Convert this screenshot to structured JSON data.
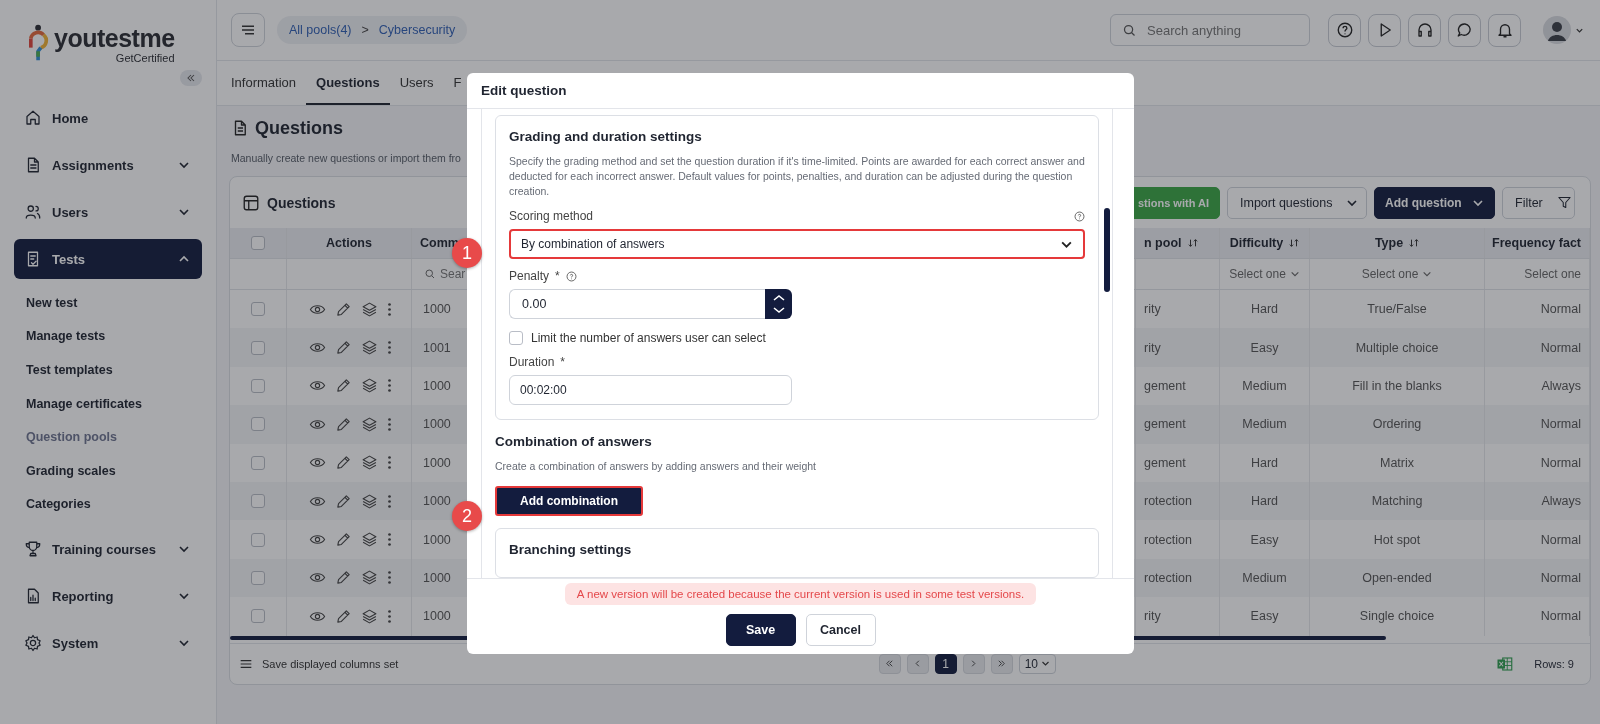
{
  "sidebar": {
    "brand": "youtestme",
    "tagline": "GetCertified",
    "items": [
      {
        "label": "Home",
        "expandable": false,
        "selected": false
      },
      {
        "label": "Assignments",
        "expandable": true,
        "expanded": false,
        "selected": false
      },
      {
        "label": "Users",
        "expandable": true,
        "expanded": false,
        "selected": false
      },
      {
        "label": "Tests",
        "expandable": true,
        "expanded": true,
        "selected": true,
        "children": [
          {
            "label": "New test",
            "selected": false
          },
          {
            "label": "Manage tests",
            "selected": false
          },
          {
            "label": "Test templates",
            "selected": false
          },
          {
            "label": "Manage certificates",
            "selected": false
          },
          {
            "label": "Question pools",
            "selected": true
          },
          {
            "label": "Grading scales",
            "selected": false
          },
          {
            "label": "Categories",
            "selected": false
          }
        ]
      },
      {
        "label": "Training courses",
        "expandable": true,
        "expanded": false,
        "selected": false
      },
      {
        "label": "Reporting",
        "expandable": true,
        "expanded": false,
        "selected": false
      },
      {
        "label": "System",
        "expandable": true,
        "expanded": false,
        "selected": false
      }
    ]
  },
  "topbar": {
    "breadcrumb": [
      {
        "label": "All pools(4)"
      },
      {
        "label": "Cybersecurity"
      }
    ],
    "separator": ">",
    "search": {
      "placeholder": "Search anything"
    }
  },
  "tabs": [
    {
      "label": "Information",
      "selected": false
    },
    {
      "label": "Questions",
      "selected": true
    },
    {
      "label": "Users",
      "selected": false
    },
    {
      "label": "F",
      "selected": false
    }
  ],
  "page": {
    "title": "Questions",
    "description": "Manually create new questions or import them fro"
  },
  "table": {
    "title": "Questions",
    "toolbar": [
      {
        "label": "stions with AI",
        "kind": "ai",
        "dropdown": false
      },
      {
        "label": "Import questions",
        "kind": "outline",
        "dropdown": true
      },
      {
        "label": "Add question",
        "kind": "primary",
        "dropdown": true
      },
      {
        "label": "Filter",
        "kind": "filter",
        "dropdown": false
      }
    ],
    "select_all": {
      "checked": false
    },
    "columns": [
      {
        "label": "Actions"
      },
      {
        "label": "Comm"
      },
      {
        "label": "n pool",
        "sortable": true
      },
      {
        "label": "Difficulty",
        "sortable": true
      },
      {
        "label": "Type",
        "sortable": true
      },
      {
        "label": "Frequency fact"
      }
    ],
    "filters": {
      "comm": {
        "placeholder": "Sear"
      },
      "difficulty": {
        "placeholder": "Select one"
      },
      "type": {
        "placeholder": "Select one"
      },
      "frequency": {
        "placeholder": "Select one"
      }
    },
    "rows": [
      {
        "checked": false,
        "code": "1000",
        "pool": "rity",
        "difficulty": "Hard",
        "type": "True/False",
        "frequency": "Normal"
      },
      {
        "checked": false,
        "code": "1001",
        "pool": "rity",
        "difficulty": "Easy",
        "type": "Multiple choice",
        "frequency": "Normal"
      },
      {
        "checked": false,
        "code": "1000",
        "pool": "gement",
        "difficulty": "Medium",
        "type": "Fill in the blanks",
        "frequency": "Always"
      },
      {
        "checked": false,
        "code": "1000",
        "pool": "gement",
        "difficulty": "Medium",
        "type": "Ordering",
        "frequency": "Normal"
      },
      {
        "checked": false,
        "code": "1000",
        "pool": "gement",
        "difficulty": "Hard",
        "type": "Matrix",
        "frequency": "Normal"
      },
      {
        "checked": false,
        "code": "1000",
        "pool": "rotection",
        "difficulty": "Hard",
        "type": "Matching",
        "frequency": "Always"
      },
      {
        "checked": false,
        "code": "1000",
        "pool": "rotection",
        "difficulty": "Easy",
        "type": "Hot spot",
        "frequency": "Normal"
      },
      {
        "checked": false,
        "code": "1000",
        "pool": "rotection",
        "difficulty": "Medium",
        "type": "Open-ended",
        "frequency": "Normal"
      },
      {
        "checked": false,
        "code": "1000",
        "pool": "rity",
        "difficulty": "Easy",
        "type": "Single choice",
        "frequency": "Normal"
      }
    ],
    "footer": {
      "save_columns": "Save displayed columns set",
      "pages": [
        {
          "label": "1",
          "selected": true
        }
      ],
      "page_size": "10",
      "rows": "Rows: 9"
    }
  },
  "modal": {
    "title": "Edit question",
    "grading": {
      "title": "Grading and duration settings",
      "description": "Specify the grading method and set the question duration if it's time-limited. Points are awarded for each correct answer and deducted for each incorrect answer. Default values for points, penalties, and duration can be adjusted during the question creation.",
      "scoring": {
        "label": "Scoring method",
        "value": "By combination of answers",
        "highlighted": true
      },
      "penalty": {
        "label": "Penalty",
        "required_mark": "*",
        "value": "0.00"
      },
      "limit": {
        "label": "Limit the number of answers user can select",
        "checked": false
      },
      "duration": {
        "label": "Duration",
        "required_mark": "*",
        "value": "00:02:00"
      }
    },
    "combination": {
      "title": "Combination of answers",
      "description": "Create a combination of answers by adding answers and their weight",
      "button": "Add combination",
      "highlighted": true
    },
    "branching": {
      "title": "Branching settings"
    },
    "warning": "A new version will be created because the current version is used in some test versions.",
    "buttons": [
      {
        "label": "Save",
        "kind": "primary"
      },
      {
        "label": "Cancel",
        "kind": "secondary"
      }
    ]
  },
  "callouts": [
    "1",
    "2"
  ]
}
